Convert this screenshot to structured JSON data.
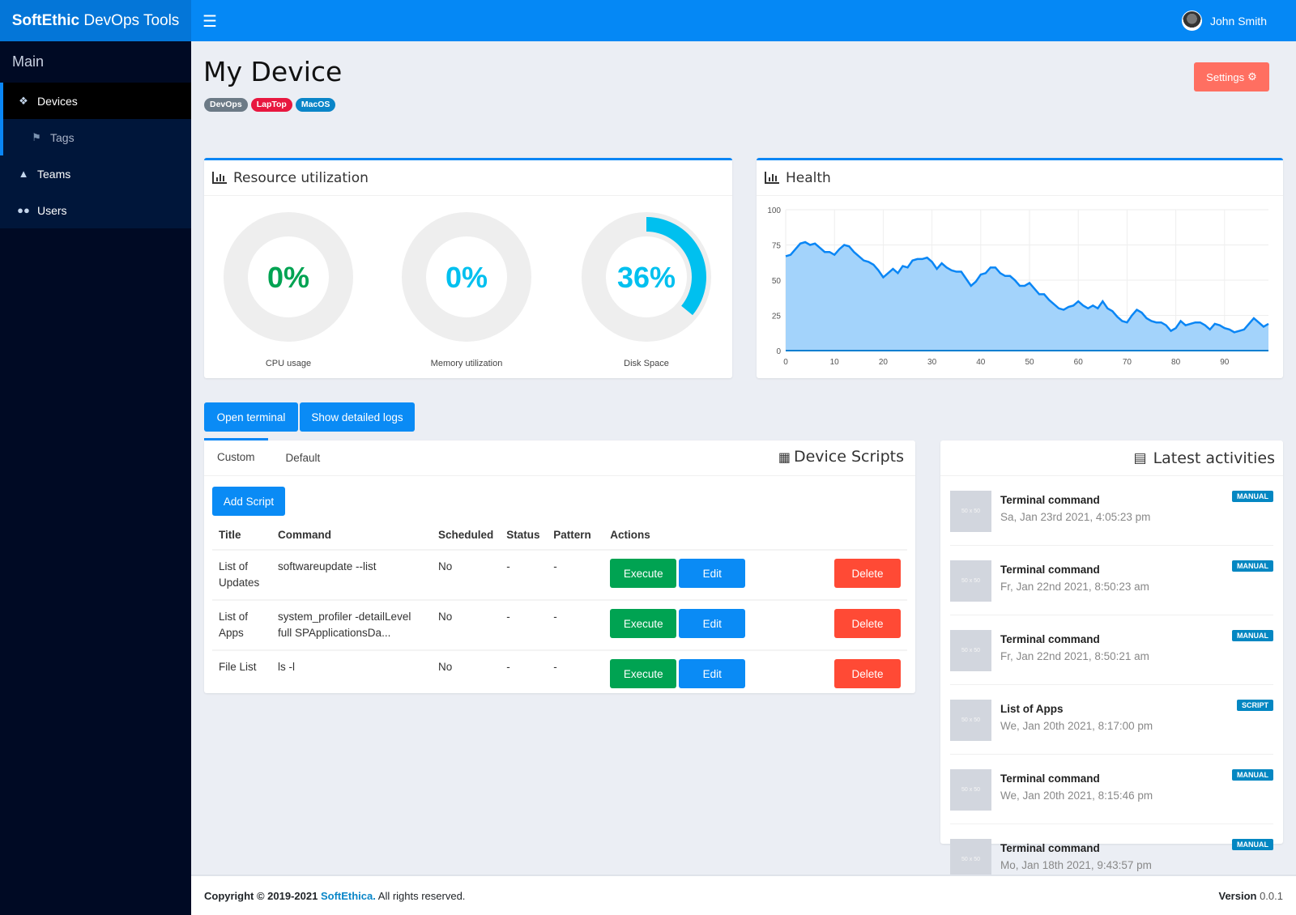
{
  "app": {
    "brand_bold": "SoftEthic",
    "brand_rest": " DevOps Tools",
    "user_name": "John Smith"
  },
  "sidebar": {
    "section": "Main",
    "items": [
      {
        "label": "Devices",
        "icon": "cubes-icon"
      },
      {
        "label": "Tags",
        "icon": "tags-icon"
      },
      {
        "label": "Teams",
        "icon": "sitemap-icon"
      },
      {
        "label": "Users",
        "icon": "users-icon"
      }
    ]
  },
  "page": {
    "title": "My Device",
    "badges": [
      {
        "label": "DevOps",
        "color": "#6c7a86"
      },
      {
        "label": "LapTop",
        "color": "#e8173f"
      },
      {
        "label": "MacOS",
        "color": "#0a85c8"
      }
    ],
    "settings_label": "Settings"
  },
  "resource": {
    "title": "Resource utilization",
    "gauges": [
      {
        "label": "CPU usage",
        "value": 0,
        "text": "0%",
        "color": "#00a352"
      },
      {
        "label": "Memory utilization",
        "value": 0,
        "text": "0%",
        "color": "#00c0ef"
      },
      {
        "label": "Disk Space",
        "value": 36,
        "text": "36%",
        "color": "#00c0ef"
      }
    ]
  },
  "health": {
    "title": "Health"
  },
  "chart_data": {
    "type": "area",
    "title": "Health",
    "xlabel": "",
    "ylabel": "",
    "xlim": [
      0,
      99
    ],
    "ylim": [
      0,
      100
    ],
    "xticks": [
      0,
      10,
      20,
      30,
      40,
      50,
      60,
      70,
      80,
      90
    ],
    "yticks": [
      0,
      25,
      50,
      75,
      100
    ],
    "grid": true,
    "series": [
      {
        "name": "Health",
        "color": "#0a86f5",
        "fill": "#a3d3fb",
        "values": [
          67,
          68,
          72,
          76,
          77,
          75,
          76,
          73,
          70,
          70,
          68,
          72,
          75,
          74,
          70,
          67,
          64,
          63,
          61,
          57,
          52,
          55,
          58,
          55,
          60,
          59,
          64,
          65,
          65,
          66,
          63,
          58,
          62,
          59,
          57,
          56,
          56,
          51,
          46,
          49,
          54,
          55,
          59,
          59,
          55,
          53,
          53,
          50,
          46,
          46,
          48,
          44,
          40,
          40,
          36,
          33,
          30,
          29,
          31,
          32,
          35,
          32,
          30,
          32,
          30,
          35,
          30,
          28,
          24,
          21,
          20,
          25,
          29,
          27,
          23,
          21,
          20,
          20,
          18,
          14,
          16,
          21,
          18,
          19,
          20,
          20,
          18,
          15,
          19,
          18,
          16,
          15,
          13,
          14,
          15,
          19,
          23,
          20,
          17,
          19
        ]
      }
    ]
  },
  "actions": {
    "open_terminal": "Open terminal",
    "show_logs": "Show detailed logs"
  },
  "scripts": {
    "title": "Device Scripts",
    "tabs": [
      "Custom",
      "Default"
    ],
    "add_label": "Add Script",
    "columns": [
      "Title",
      "Command",
      "Scheduled",
      "Status",
      "Pattern",
      "Actions"
    ],
    "rows": [
      {
        "title": "List of Updates",
        "command": "softwareupdate --list",
        "scheduled": "No",
        "status": "-",
        "pattern": "-"
      },
      {
        "title": "List of Apps",
        "command": "system_profiler -detailLevel full SPApplicationsDa...",
        "scheduled": "No",
        "status": "-",
        "pattern": "-"
      },
      {
        "title": "File List",
        "command": "ls -l",
        "scheduled": "No",
        "status": "-",
        "pattern": "-"
      }
    ],
    "execute_label": "Execute",
    "edit_label": "Edit",
    "delete_label": "Delete"
  },
  "activities": {
    "title": "Latest activities",
    "placeholder": "50 x 50",
    "items": [
      {
        "title": "Terminal command",
        "date": "Sa, Jan 23rd 2021, 4:05:23 pm",
        "badge": "MANUAL"
      },
      {
        "title": "Terminal command",
        "date": "Fr, Jan 22nd 2021, 8:50:23 am",
        "badge": "MANUAL"
      },
      {
        "title": "Terminal command",
        "date": "Fr, Jan 22nd 2021, 8:50:21 am",
        "badge": "MANUAL"
      },
      {
        "title": "List of Apps",
        "date": "We, Jan 20th 2021, 8:17:00 pm",
        "badge": "SCRIPT"
      },
      {
        "title": "Terminal command",
        "date": "We, Jan 20th 2021, 8:15:46 pm",
        "badge": "MANUAL"
      },
      {
        "title": "Terminal command",
        "date": "Mo, Jan 18th 2021, 9:43:57 pm",
        "badge": "MANUAL"
      }
    ]
  },
  "footer": {
    "copyright": "Copyright © 2019-2021 ",
    "company": "SoftEthica.",
    "rights": " All rights reserved.",
    "version_label": "Version",
    "version": " 0.0.1"
  }
}
